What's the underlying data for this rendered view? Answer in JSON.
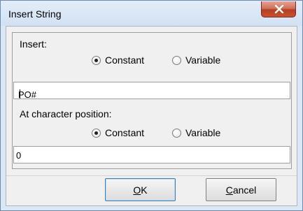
{
  "window": {
    "title": "Insert String",
    "close_icon": "close-x-icon"
  },
  "insert": {
    "label": "Insert:",
    "options": [
      "Constant",
      "Variable"
    ],
    "selected": "Constant",
    "value": "PO#"
  },
  "position": {
    "label": "At character position:",
    "options": [
      "Constant",
      "Variable"
    ],
    "selected": "Constant",
    "value": "0"
  },
  "buttons": {
    "ok": {
      "mnemonic": "O",
      "rest": "K"
    },
    "cancel": {
      "mnemonic": "C",
      "rest": "ancel"
    }
  },
  "colors": {
    "frame": "#dbe7f5",
    "client": "#f0f0f0",
    "close": "#c9532f"
  }
}
